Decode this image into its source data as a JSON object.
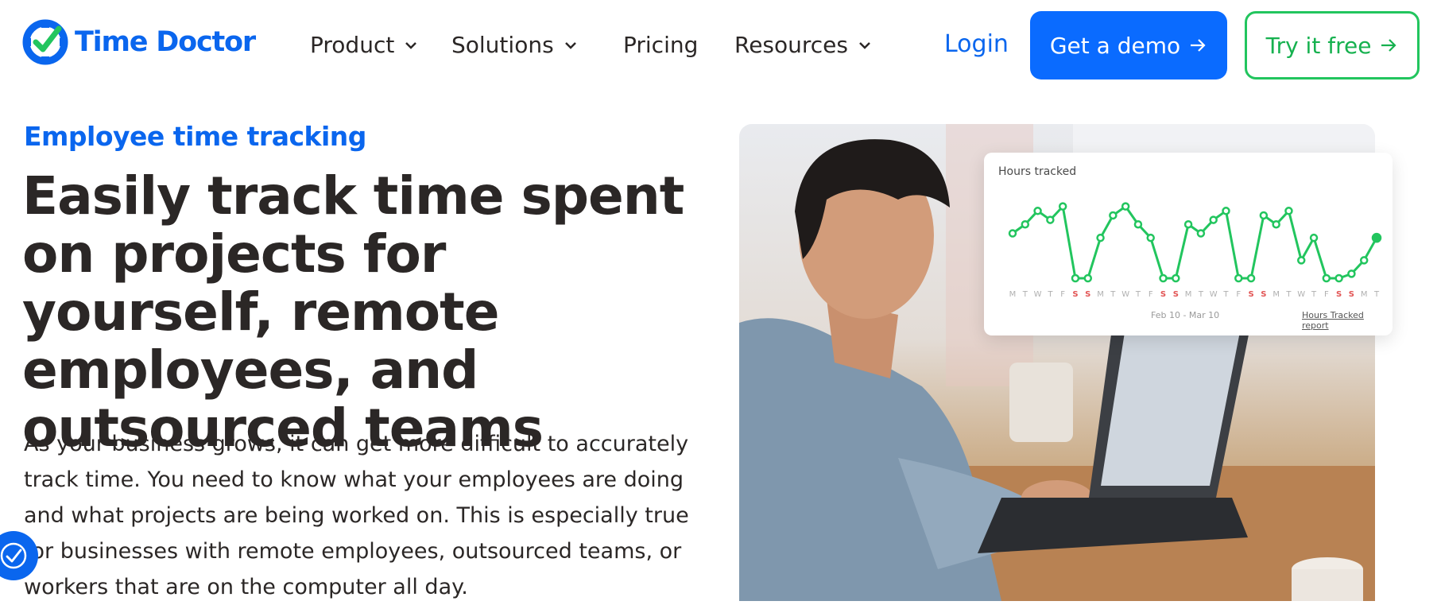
{
  "header": {
    "logo_text": "Time Doctor",
    "nav": [
      {
        "label": "Product",
        "dropdown": true
      },
      {
        "label": "Solutions",
        "dropdown": true
      },
      {
        "label": "Pricing",
        "dropdown": false
      },
      {
        "label": "Resources",
        "dropdown": true
      }
    ],
    "login_label": "Login",
    "demo_label": "Get a demo",
    "try_label": "Try it free"
  },
  "hero": {
    "eyebrow": "Employee time tracking",
    "headline": "Easily track time spent on projects for yourself, remote employees, and outsourced teams",
    "body": "As your business grows, it can get more difficult to accurately track time. You need to know what your employees are doing and what projects are being worked on. This is especially true for businesses with remote employees, outsourced teams, or workers that are on the computer all day."
  },
  "card": {
    "title": "Hours tracked",
    "date_range": "Feb 10 - Mar 10",
    "report_link": "Hours Tracked report"
  },
  "colors": {
    "brand_blue": "#0a66ee",
    "cta_blue": "#0a6bff",
    "green": "#22c55e",
    "weekend_red": "#e25555"
  },
  "chart_data": {
    "type": "line",
    "title": "Hours tracked",
    "x": [
      "M",
      "T",
      "W",
      "T",
      "F",
      "S",
      "S",
      "M",
      "T",
      "W",
      "T",
      "F",
      "S",
      "S",
      "M",
      "T",
      "W",
      "T",
      "F",
      "S",
      "S",
      "M",
      "T",
      "W",
      "T",
      "F",
      "S",
      "S",
      "M",
      "T"
    ],
    "weekend_days": [
      5,
      6,
      12,
      13,
      19,
      20,
      26,
      27
    ],
    "series": [
      {
        "values": [
          5,
          6,
          7.5,
          6.5,
          8,
          0,
          0,
          4.5,
          7,
          8,
          6,
          4.5,
          0,
          0,
          6,
          5,
          6.5,
          7.5,
          0,
          0,
          7,
          6,
          7.5,
          2,
          4.5,
          0,
          0,
          0.5,
          2,
          4.5
        ]
      }
    ],
    "ylim": [
      0,
      8.5
    ],
    "grid": false,
    "legend": "none"
  }
}
